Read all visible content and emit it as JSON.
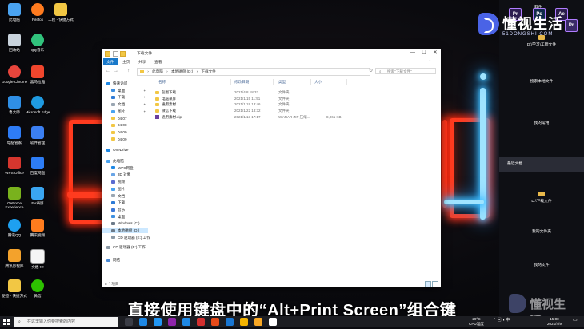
{
  "desktop_icons": [
    {
      "label": "此电脑",
      "color": "#4aa3f0"
    },
    {
      "label": "回收站",
      "color": "#c9d3dc"
    },
    {
      "label": "Google Chrome",
      "color": "#e8453c"
    },
    {
      "label": "鲁大师",
      "color": "#2f8fe6"
    },
    {
      "label": "电脑管家",
      "color": "#2e7cf6"
    },
    {
      "label": "WPS Office",
      "color": "#d6362e"
    },
    {
      "label": "GeForce Experience",
      "color": "#79b21d"
    },
    {
      "label": "腾讯QQ",
      "color": "#1ea0f0"
    },
    {
      "label": "腾讯影视库",
      "color": "#f3a22c"
    },
    {
      "label": "便签 - 快捷方式",
      "color": "#f2c744"
    },
    {
      "label": "Firefox",
      "color": "#ff7b1f"
    },
    {
      "label": "QQ音乐",
      "color": "#31c27c"
    },
    {
      "label": "喜马拉雅",
      "color": "#f0462d"
    },
    {
      "label": "Microsoft Edge",
      "color": "#1f9ae0"
    },
    {
      "label": "软件管理",
      "color": "#3b7ff2"
    },
    {
      "label": "百度网盘",
      "color": "#2d7df6"
    },
    {
      "label": "EV录屏",
      "color": "#3aa5f0"
    },
    {
      "label": "腾讯视频",
      "color": "#ff7c1e"
    },
    {
      "label": "文档.txt",
      "color": "#f5f5f5"
    },
    {
      "label": "微信",
      "color": "#2dc100"
    },
    {
      "label": "工程 - 快捷方式",
      "color": "#f2c744"
    }
  ],
  "right_panel": {
    "top_label": "软件",
    "brand_cn": "懂视生活",
    "brand_en": "51DONGSHI.COM",
    "app_icons": [
      {
        "text": "Pr",
        "color": "#2c1f4e"
      },
      {
        "text": "Ps",
        "color": "#0f2a4a"
      },
      {
        "text": "Ae",
        "color": "#2b1c4a"
      },
      {
        "text": "Pr",
        "color": "#3a2a66"
      }
    ],
    "rows": [
      {
        "label": "D:\\学习\\工程文件",
        "folder": true
      },
      {
        "label": "搜索本地文件",
        "folder": false
      },
      {
        "label": "我的常用",
        "folder": false
      },
      {
        "label": "最近文档",
        "folder": false,
        "active": true
      },
      {
        "label": "D:\\下载文件",
        "folder": true
      },
      {
        "label": "我的文件夹",
        "folder": false
      },
      {
        "label": "我的文件",
        "folder": false
      }
    ]
  },
  "explorer": {
    "title": "下载文件",
    "window_controls": {
      "minimize": "—",
      "maximize": "☐",
      "close": "✕"
    },
    "ribbon_tabs": [
      "文件",
      "主页",
      "共享",
      "查看"
    ],
    "address": {
      "segments": [
        "此电脑",
        "本地磁盘 (D:)",
        "下载文件"
      ]
    },
    "search_placeholder": "搜索\"下载文件\"",
    "nav_pane": [
      {
        "label": "快速访问",
        "type": "star",
        "indent": 0
      },
      {
        "label": "桌面",
        "type": "desk",
        "indent": 1,
        "pinned": true
      },
      {
        "label": "下载",
        "type": "down",
        "indent": 1,
        "pinned": true
      },
      {
        "label": "文档",
        "type": "doc",
        "indent": 1,
        "pinned": true
      },
      {
        "label": "图片",
        "type": "pic",
        "indent": 1,
        "pinned": true
      },
      {
        "label": "04.07",
        "type": "folder",
        "indent": 1
      },
      {
        "label": "04.08",
        "type": "folder",
        "indent": 1
      },
      {
        "label": "04.09",
        "type": "folder",
        "indent": 1
      },
      {
        "label": "04.09",
        "type": "folder",
        "indent": 1
      },
      {
        "label": "OneDrive",
        "type": "cloud",
        "indent": 0
      },
      {
        "label": "此电脑",
        "type": "pc",
        "indent": 0
      },
      {
        "label": "WPS网盘",
        "type": "cloud",
        "indent": 1
      },
      {
        "label": "3D 对象",
        "type": "3d",
        "indent": 1
      },
      {
        "label": "视频",
        "type": "video",
        "indent": 1
      },
      {
        "label": "图片",
        "type": "pic",
        "indent": 1
      },
      {
        "label": "文档",
        "type": "doc",
        "indent": 1
      },
      {
        "label": "下载",
        "type": "down",
        "indent": 1
      },
      {
        "label": "音乐",
        "type": "music",
        "indent": 1
      },
      {
        "label": "桌面",
        "type": "desk",
        "indent": 1
      },
      {
        "label": "Windows (C:)",
        "type": "drive",
        "indent": 1
      },
      {
        "label": "本地磁盘 (D:)",
        "type": "drive",
        "indent": 1,
        "selected": true
      },
      {
        "label": "CD 驱动器 (E:) 工作",
        "type": "cd",
        "indent": 1
      },
      {
        "label": "CD 驱动器 (E:) 工作",
        "type": "cd",
        "indent": 0
      },
      {
        "label": "网络",
        "type": "net",
        "indent": 0
      }
    ],
    "columns": [
      "名称",
      "修改日期",
      "类型",
      "大小"
    ],
    "files": [
      {
        "name": "包图下载",
        "date": "2021/4/8 18:33",
        "type": "文件夹",
        "size": "",
        "kind": "folder"
      },
      {
        "name": "电脑录屏",
        "date": "2021/1/15 11:51",
        "type": "文件夹",
        "size": "",
        "kind": "folder"
      },
      {
        "name": "通用素材",
        "date": "2021/1/19 13:46",
        "type": "文件夹",
        "size": "",
        "kind": "folder"
      },
      {
        "name": "微信下载",
        "date": "2021/1/22 18:32",
        "type": "文件夹",
        "size": "",
        "kind": "folder"
      },
      {
        "name": "通用素材.zip",
        "date": "2021/1/13 17:17",
        "type": "WinRAR ZIP 压缩...",
        "size": "8,061 KB",
        "kind": "zip"
      }
    ],
    "status": "5 个项目"
  },
  "subtitle": "直接使用键盘中的“Alt+Print Screen”组合键",
  "taskbar": {
    "search_placeholder": "在这里输入你要搜索的内容",
    "temp": "29°C",
    "cpu": "CPU温度",
    "time": "15:00",
    "date": "2021/4/9",
    "pinned_colors": [
      "#3a3c45",
      "#1e88e5",
      "#2196f3",
      "#8e24aa",
      "#1e88e5",
      "#d32f2f",
      "#e64a19",
      "#1976d2",
      "#f4b400",
      "#f9a825",
      "#ffffff"
    ]
  },
  "watermark_cn": "懂视生活"
}
